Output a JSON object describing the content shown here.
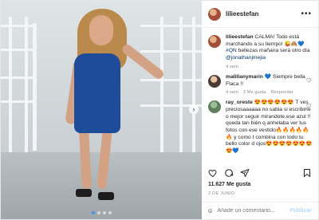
{
  "post": {
    "author": "lilieestefan",
    "author_avatar_icon": "profile-avatar",
    "more_icon": "more-options-icon"
  },
  "comments": [
    {
      "username": "lilieestefan",
      "text": " CALMA! Todo está marchando a su tiempo! 😜🙈💙 ",
      "hashtag": "#QN",
      "text2": " bellezas mañana será otro día ",
      "mention": "@jonathanjmejia",
      "time": "4 sem"
    },
    {
      "username": "malillanymarin",
      "text": " 💙 Siempre bella Flaca !!",
      "time": "4 sem",
      "likes": "3 Me gusta",
      "reply": "Responder"
    },
    {
      "username": "ray_oreste",
      "text": " 😍😍😍😍😍😍 T ves preciosaaaaaa no sabia si escribirte o mejor seguir mirandote,ese azul !! queda tan bién q anhelaba ver tus fotos con ese vestido🔥🔥🔥🔥🔥🔥 y como t combina con todo tu bello color d ojos😍😍😍😍😍😍😍😍💙"
    }
  ],
  "stats": {
    "likes": "11.627 Me gusta",
    "date": "2 DE JUNIO"
  },
  "add_comment": {
    "placeholder": "Añade un comentario...",
    "publish": "Publicar"
  },
  "carousel": {
    "current": 1,
    "total": 4
  },
  "colors": {
    "link": "#00376b",
    "accent": "#3897f0",
    "dress": "#1f4c9a"
  }
}
